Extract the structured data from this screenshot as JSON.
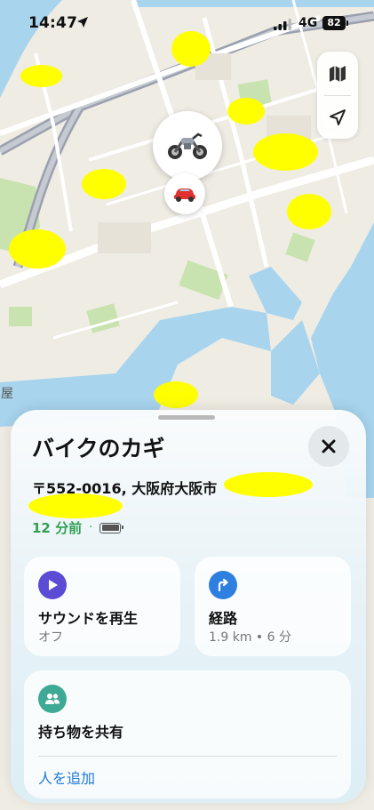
{
  "status_bar": {
    "time": "14:47",
    "network": "4G",
    "battery": "82"
  },
  "map": {
    "place_label": "屋"
  },
  "sheet": {
    "title": "バイクのカギ",
    "address": "〒552-0016, 大阪府大阪市",
    "last_seen": "12 分前",
    "meta_separator": "·",
    "actions": {
      "sound": {
        "label": "サウンドを再生",
        "sub": "オフ"
      },
      "route": {
        "label": "経路",
        "sub": "1.9 km • 6 分"
      }
    },
    "share": {
      "label": "持ち物を共有",
      "add_people": "人を追加"
    }
  },
  "icons": {
    "map_mode": "map-icon",
    "locate": "location-arrow-icon",
    "close": "close-icon",
    "sound": "play-icon",
    "route": "turn-right-arrow-icon",
    "share": "people-icon",
    "bike": "motorcycle-icon",
    "car": "car-icon"
  },
  "colors": {
    "accent_green": "#2f9f52",
    "link_blue": "#1f7ad8",
    "sound_icon_bg": "#5b4bd5",
    "route_icon_bg": "#2d7fe0",
    "share_icon_bg": "#3ea994",
    "redaction": "#ffff00"
  }
}
